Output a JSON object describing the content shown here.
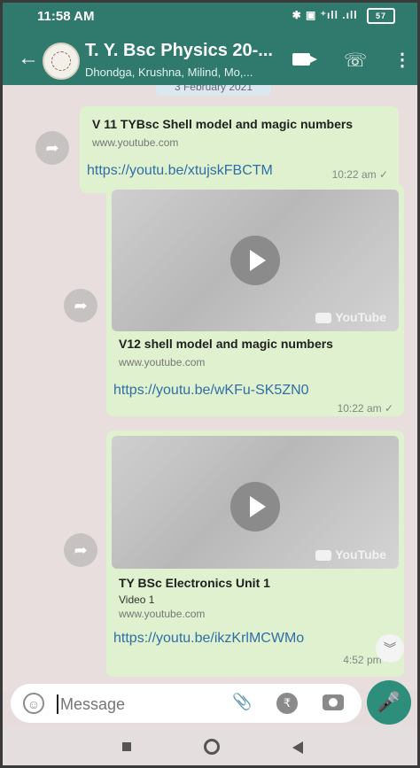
{
  "status": {
    "time": "11:58 AM",
    "icons": "✱ ▣ ⁺ıll .ıll",
    "battery": "57"
  },
  "chat": {
    "title": "T. Y. Bsc Physics 20-...",
    "subtitle": "Dhondga, Krushna, Milind, Mo,...",
    "date_chip": "3 February 2021"
  },
  "messages": [
    {
      "title": "V 11 TYBsc Shell model and magic numbers",
      "source": "www.youtube.com",
      "link": "https://youtu.be/xtujskFBCTM",
      "time": "10:22 am ✓"
    },
    {
      "title": "V12 shell model and magic numbers",
      "source": "www.youtube.com",
      "link": "https://youtu.be/wKFu-SK5ZN0",
      "time": "10:22 am ✓",
      "brand": "YouTube"
    },
    {
      "title": "TY BSc Electronics Unit 1",
      "desc": "Video 1",
      "source": "www.youtube.com",
      "link": "https://youtu.be/ikzKrlMCWMo",
      "time": "4:52 pm ✓",
      "brand": "YouTube"
    }
  ],
  "composer": {
    "placeholder": "Message"
  },
  "icons": {
    "back": "arrow-left",
    "video": "video-camera",
    "call": "phone",
    "menu": "more-vert",
    "forward": "share",
    "emoji": "smiley",
    "attach": "paperclip",
    "pay": "rupee",
    "camera": "camera",
    "mic": "microphone",
    "scroll": "double-chevron-down"
  }
}
